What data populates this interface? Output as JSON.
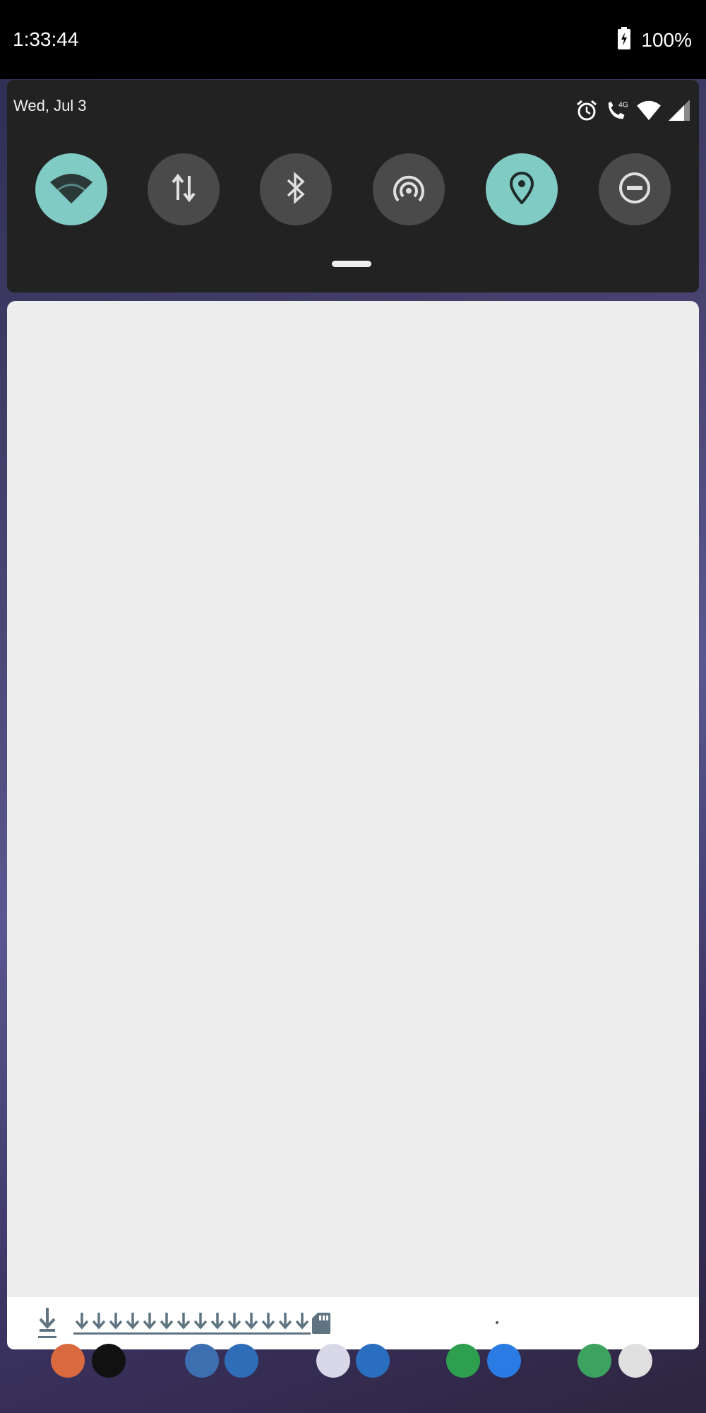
{
  "status_bar": {
    "time": "1:33:44",
    "battery_percent": "100%",
    "icons": [
      "battery-charging-icon"
    ]
  },
  "quick_settings": {
    "date": "Wed, Jul 3",
    "status_icons": [
      "alarm-icon",
      "wifi-calling-4g-icon",
      "wifi-signal-icon",
      "cell-signal-icon"
    ],
    "volte_label": "4G",
    "tiles": [
      {
        "name": "wifi",
        "icon": "wifi-icon",
        "state": "on"
      },
      {
        "name": "mobile-data",
        "icon": "data-arrows-icon",
        "state": "off"
      },
      {
        "name": "bluetooth",
        "icon": "bluetooth-icon",
        "state": "off"
      },
      {
        "name": "hotspot",
        "icon": "hotspot-icon",
        "state": "off"
      },
      {
        "name": "location",
        "icon": "location-pin-icon",
        "state": "on"
      },
      {
        "name": "do-not-disturb",
        "icon": "dnd-icon",
        "state": "off"
      }
    ]
  },
  "notification_strip": {
    "icons": [
      "download-icon",
      "download-icon",
      "download-icon",
      "download-icon",
      "download-icon",
      "download-icon",
      "download-icon",
      "download-icon",
      "download-icon",
      "download-icon",
      "download-icon",
      "download-icon",
      "download-icon",
      "download-icon",
      "download-icon",
      "sd-card-icon"
    ]
  },
  "colors": {
    "tile_on": "#80cbc4",
    "tile_off": "#4a4a4a",
    "panel_bg": "#222222",
    "notification_bg": "#ededed",
    "download_icon": "#5f7480"
  }
}
